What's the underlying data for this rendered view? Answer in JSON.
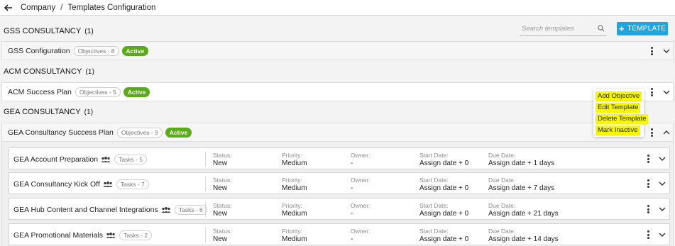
{
  "breadcrumb": {
    "root": "Company",
    "separator": "/",
    "current": "Templates Configuration"
  },
  "search": {
    "placeholder": "Search templates"
  },
  "add_button": {
    "label": "TEMPLATE"
  },
  "groups": [
    {
      "name": "GSS CONSULTANCY",
      "count": "(1)",
      "template": {
        "name": "GSS Configuration",
        "objectives": "Objectives - 8",
        "status": "Active"
      }
    },
    {
      "name": "ACM CONSULTANCY",
      "count": "(1)",
      "template": {
        "name": "ACM Success Plan",
        "objectives": "Objectives - 5",
        "status": "Active"
      }
    },
    {
      "name": "GEA CONSULTANCY",
      "count": "(1)",
      "template": {
        "name": "GEA Consultancy Success Plan",
        "objectives": "Objectives - 9",
        "status": "Active"
      }
    }
  ],
  "menu": {
    "items": [
      "Add Objective",
      "Edit Template",
      "Delete Template",
      "Mark Inactive"
    ]
  },
  "field_labels": {
    "status": "Status:",
    "priority": "Priority:",
    "owner": "Owner:",
    "start": "Start Date:",
    "due": "Due Date:"
  },
  "tasks": [
    {
      "name": "GEA Account Preparation",
      "tasks": "Tasks - 5",
      "status": "New",
      "priority": "Medium",
      "owner": "-",
      "start": "Assign date + 0",
      "due": "Assign date + 1 days"
    },
    {
      "name": "GEA Consultancy Kick Off",
      "tasks": "Tasks - 7",
      "status": "New",
      "priority": "Medium",
      "owner": "-",
      "start": "Assign date + 0",
      "due": "Assign date + 7 days"
    },
    {
      "name": "GEA Hub Content and Channel Integrations",
      "tasks": "Tasks - 6",
      "status": "New",
      "priority": "Medium",
      "owner": "-",
      "start": "Assign date + 0",
      "due": "Assign date + 21 days"
    },
    {
      "name": "GEA Promotional Materials",
      "tasks": "Tasks - 2",
      "status": "New",
      "priority": "Medium",
      "owner": "-",
      "start": "Assign date + 0",
      "due": "Assign date + 14 days"
    }
  ],
  "colors": {
    "accent": "#1ea6e0",
    "active_badge": "#5aab1a",
    "highlight": "#f7f700"
  }
}
